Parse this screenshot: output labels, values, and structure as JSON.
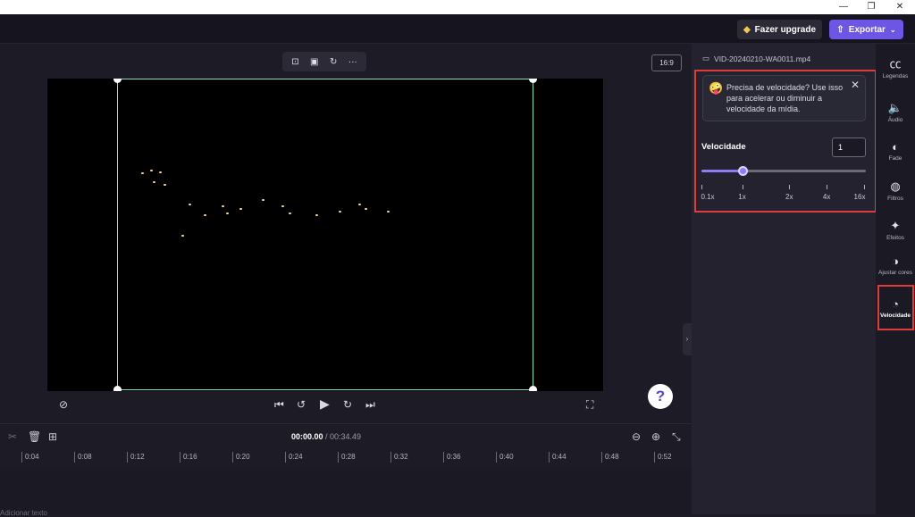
{
  "window": {
    "minimize": "—",
    "restore": "❐",
    "close": "✕"
  },
  "header": {
    "upgrade_label": "Fazer upgrade",
    "export_label": "Exportar"
  },
  "stage": {
    "aspect_ratio": "16:9",
    "toolbar": {
      "crop": "⊡",
      "fit": "▣",
      "rotate": "↻",
      "more": "···"
    }
  },
  "playback": {
    "current_time": "00:00.00",
    "total_time": "/ 00:34.49"
  },
  "timeline": {
    "ticks": [
      "0:04",
      "0:08",
      "0:12",
      "0:16",
      "0:20",
      "0:24",
      "0:28",
      "0:32",
      "0:36",
      "0:40",
      "0:44",
      "0:48",
      "0:52"
    ],
    "add_label": "Adicionar texto"
  },
  "panel": {
    "filename": "VID-20240210-WA0011.mp4",
    "tip_text": "Precisa de velocidade? Use isso para acelerar ou diminuir a velocidade da mídia.",
    "speed_label": "Velocidade",
    "speed_value": "1",
    "slider_fraction": 0.25,
    "slider_labels": [
      "0.1x",
      "1x",
      "2x",
      "4x",
      "16x"
    ]
  },
  "rail": {
    "items": [
      {
        "label": "Legendas",
        "icon": "captions-icon"
      },
      {
        "label": "Áudio",
        "icon": "speaker-icon"
      },
      {
        "label": "Fade",
        "icon": "fade-icon"
      },
      {
        "label": "Filtros",
        "icon": "filters-icon"
      },
      {
        "label": "Efeitos",
        "icon": "wand-icon"
      },
      {
        "label": "Ajustar cores",
        "icon": "contrast-icon"
      },
      {
        "label": "Velocidade",
        "icon": "speedometer-icon"
      }
    ]
  },
  "colors": {
    "accent": "#6d56e6",
    "highlight": "#e03c3c",
    "frame": "#7ee3c1"
  }
}
